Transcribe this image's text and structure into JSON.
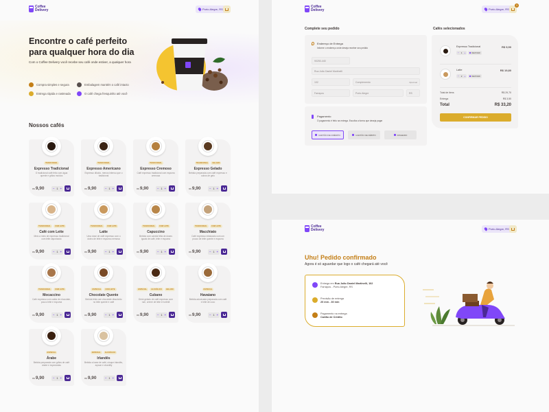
{
  "brand": {
    "name": "Coffee Delivery",
    "location": "Porto Alegre, RS",
    "cart_count": "3"
  },
  "colors": {
    "purple": "#8047f8",
    "purple_dark": "#4b2995",
    "yellow": "#dbac2c",
    "yellow_dark": "#c47f17"
  },
  "home": {
    "hero_title": "Encontre o café perfeito para qualquer hora do dia",
    "hero_subtitle": "Com o Coffee Delivery você recebe seu café onde estiver, a qualquer hora",
    "features": [
      {
        "icon": "cart-icon",
        "label": "Compra simples e segura",
        "color": "#c47f17"
      },
      {
        "icon": "package-icon",
        "label": "Embalagem mantém o café intacto",
        "color": "#574f4d"
      },
      {
        "icon": "timer-icon",
        "label": "Entrega rápida e rastreada",
        "color": "#dbac2c"
      },
      {
        "icon": "coffee-icon",
        "label": "O café chega fresquinho até você",
        "color": "#8047f8"
      }
    ],
    "section_title": "Nossos cafés",
    "currency": "R$",
    "products": [
      {
        "name": "Expresso Tradicional",
        "tags": [
          "TRADICIONAL"
        ],
        "desc": "O tradicional café feito com água quente e grãos moídos",
        "price": "9,90",
        "qty": "1",
        "liquid": "#2a1a10"
      },
      {
        "name": "Expresso Americano",
        "tags": [
          "TRADICIONAL"
        ],
        "desc": "Expresso diluído, menos intenso que o tradicional",
        "price": "9,90",
        "qty": "1",
        "liquid": "#3b2414"
      },
      {
        "name": "Expresso Cremoso",
        "tags": [
          "TRADICIONAL"
        ],
        "desc": "Café expresso tradicional com espuma cremosa",
        "price": "9,90",
        "qty": "1",
        "liquid": "#b5803e"
      },
      {
        "name": "Expresso Gelado",
        "tags": [
          "TRADICIONAL",
          "GELADO"
        ],
        "desc": "Bebida preparada com café expresso e cubos de gelo",
        "price": "9,90",
        "qty": "1",
        "liquid": "#5a3a20"
      },
      {
        "name": "Café com Leite",
        "tags": [
          "TRADICIONAL",
          "COM LEITE"
        ],
        "desc": "Meio a meio de expresso tradicional com leite vaporizado",
        "price": "9,90",
        "qty": "1",
        "liquid": "#d8b48a"
      },
      {
        "name": "Latte",
        "tags": [
          "TRADICIONAL",
          "COM LEITE"
        ],
        "desc": "Uma dose de café expresso com o dobro de leite e espuma cremosa",
        "price": "9,90",
        "qty": "1",
        "liquid": "#c9995e"
      },
      {
        "name": "Capuccino",
        "tags": [
          "TRADICIONAL",
          "COM LEITE"
        ],
        "desc": "Bebida com canela feita de doses iguais de café, leite e espuma",
        "price": "9,90",
        "qty": "1",
        "liquid": "#b88649"
      },
      {
        "name": "Macchiato",
        "tags": [
          "TRADICIONAL",
          "COM LEITE"
        ],
        "desc": "Café expresso misturado com um pouco de leite quente e espuma",
        "price": "9,90",
        "qty": "1",
        "liquid": "#c3a27b"
      },
      {
        "name": "Mocaccino",
        "tags": [
          "TRADICIONAL",
          "COM LEITE"
        ],
        "desc": "Café expresso com calda de chocolate, pouco leite e espuma",
        "price": "9,90",
        "qty": "1",
        "liquid": "#a8764a"
      },
      {
        "name": "Chocolate Quente",
        "tags": [
          "ESPECIAL",
          "COM LEITE"
        ],
        "desc": "Bebida feita com chocolate dissolvido no leite quente e café",
        "price": "9,90",
        "qty": "1",
        "liquid": "#7a4a26"
      },
      {
        "name": "Cubano",
        "tags": [
          "ESPECIAL",
          "ALCOÓLICO",
          "GELADO"
        ],
        "desc": "Drink gelado de café expresso com rum, creme de leite e hortelã",
        "price": "9,90",
        "qty": "1",
        "liquid": "#4a2a14"
      },
      {
        "name": "Havaiano",
        "tags": [
          "ESPECIAL"
        ],
        "desc": "Bebida adocicada preparada com café e leite de coco",
        "price": "9,90",
        "qty": "1",
        "liquid": "#9a6a3a"
      },
      {
        "name": "Árabe",
        "tags": [
          "ESPECIAL"
        ],
        "desc": "Bebida preparada com grãos de café árabe e especiarias",
        "price": "9,90",
        "qty": "1",
        "liquid": "#3a2010"
      },
      {
        "name": "Irlandês",
        "tags": [
          "ESPECIAL",
          "ALCOÓLICO"
        ],
        "desc": "Bebida a base de café, uísque irlandês, açúcar e chantilly",
        "price": "9,90",
        "qty": "1",
        "liquid": "#d9c2a0"
      }
    ]
  },
  "checkout": {
    "title_form": "Complete seu pedido",
    "title_cart": "Cafés selecionados",
    "address_title": "Endereço de Entrega",
    "address_sub": "Informe o endereço onde deseja receber seu pedido",
    "fields": {
      "cep": "90250-440",
      "rua": "Rua João Daniel Martinelli",
      "numero": "102",
      "complemento": "Complemento",
      "opcional": "Opcional",
      "bairro": "Farrapos",
      "cidade": "Porto Alegre",
      "uf": "RS"
    },
    "payment_title": "Pagamento",
    "payment_sub": "O pagamento é feito na entrega. Escolha a forma que deseja pagar",
    "payment_options": [
      "CARTÃO DE CRÉDITO",
      "CARTÃO DE DÉBITO",
      "DINHEIRO"
    ],
    "items": [
      {
        "name": "Expresso Tradicional",
        "price": "R$ 9,90",
        "qty": "1",
        "remove": "REMOVER",
        "liquid": "#2a1a10"
      },
      {
        "name": "Latte",
        "price": "R$ 19,80",
        "qty": "2",
        "remove": "REMOVER",
        "liquid": "#c9995e"
      }
    ],
    "totals": {
      "items_label": "Total de itens",
      "items_value": "R$ 29,70",
      "delivery_label": "Entrega",
      "delivery_value": "R$ 3,50",
      "total_label": "Total",
      "total_value": "R$ 33,20"
    },
    "confirm_label": "CONFIRMAR PEDIDO"
  },
  "success": {
    "title": "Uhu! Pedido confirmado",
    "subtitle": "Agora é só aguardar que logo o café chegará até você",
    "address_prefix": "Entrega em",
    "address_street": "Rua João Daniel Martinelli, 102",
    "address_city": "Farrapos - Porto Alegre, RS",
    "eta_label": "Previsão de entrega",
    "eta_value": "20 min - 30 min",
    "pay_label": "Pagamento na entrega",
    "pay_value": "Cartão de Crédito"
  }
}
